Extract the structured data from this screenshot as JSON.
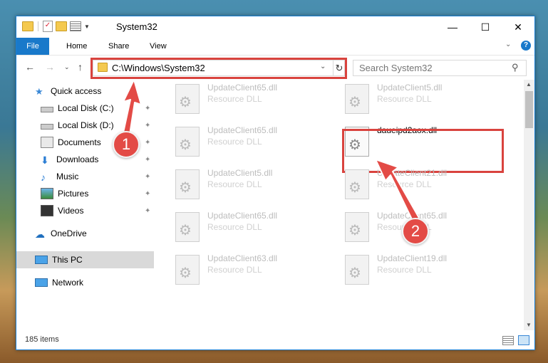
{
  "window": {
    "title": "System32",
    "controls": {
      "minimize": "—",
      "maximize": "☐",
      "close": "✕"
    }
  },
  "ribbon": {
    "tabs": [
      "File",
      "Home",
      "Share",
      "View"
    ],
    "help": "?"
  },
  "address": {
    "path": "C:\\Windows\\System32",
    "search_placeholder": "Search System32"
  },
  "sidebar": {
    "quick_access": "Quick access",
    "items": [
      {
        "label": "Local Disk (C:)",
        "icon": "drive-icon",
        "pinned": true
      },
      {
        "label": "Local Disk (D:)",
        "icon": "drive-icon",
        "pinned": true
      },
      {
        "label": "Documents",
        "icon": "documents-icon",
        "pinned": true
      },
      {
        "label": "Downloads",
        "icon": "downloads-icon",
        "pinned": true
      },
      {
        "label": "Music",
        "icon": "music-icon",
        "pinned": true
      },
      {
        "label": "Pictures",
        "icon": "pictures-icon",
        "pinned": true
      },
      {
        "label": "Videos",
        "icon": "videos-icon",
        "pinned": true
      }
    ],
    "onedrive": "OneDrive",
    "this_pc": "This PC",
    "network": "Network"
  },
  "files": [
    {
      "name": "UpdateClient65.dll",
      "type": "Resource DLL"
    },
    {
      "name": "UpdateClient5.dll",
      "type": "Resource DLL"
    },
    {
      "name": "UpdateClient65.dll",
      "type": "Resource DLL"
    },
    {
      "name": "daueipd2aox.dll",
      "type": ""
    },
    {
      "name": "UpdateClient5.dll",
      "type": "Resource DLL"
    },
    {
      "name": "UpdateClient21.dll",
      "type": "Resource DLL"
    },
    {
      "name": "UpdateClient65.dll",
      "type": "Resource DLL"
    },
    {
      "name": "UpdateClient65.dll",
      "type": "Resource DLL"
    },
    {
      "name": "UpdateClient63.dll",
      "type": "Resource DLL"
    },
    {
      "name": "UpdateClient19.dll",
      "type": "Resource DLL"
    }
  ],
  "status": {
    "items_count": "185 items"
  },
  "annotations": {
    "step1": "1",
    "step2": "2",
    "highlight_color": "#d9433e"
  }
}
